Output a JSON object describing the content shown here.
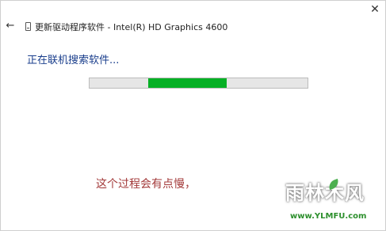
{
  "window": {
    "title": "更新驱动程序软件 - Intel(R) HD Graphics 4600",
    "back_glyph": "←",
    "close_glyph": "✕"
  },
  "main": {
    "status_text": "正在联机搜索软件...",
    "progress": {
      "mode": "indeterminate",
      "segment_start_fraction": 0.27,
      "segment_end_fraction": 0.63,
      "fill_color": "#06b025"
    }
  },
  "annotation": {
    "caption": "这个过程会有点慢，"
  },
  "watermark": {
    "brand_text": "雨林木风",
    "url_text": "www.YLMFU.com"
  },
  "icons": {
    "back": "back-arrow-icon",
    "device": "device-icon",
    "close": "close-icon"
  }
}
